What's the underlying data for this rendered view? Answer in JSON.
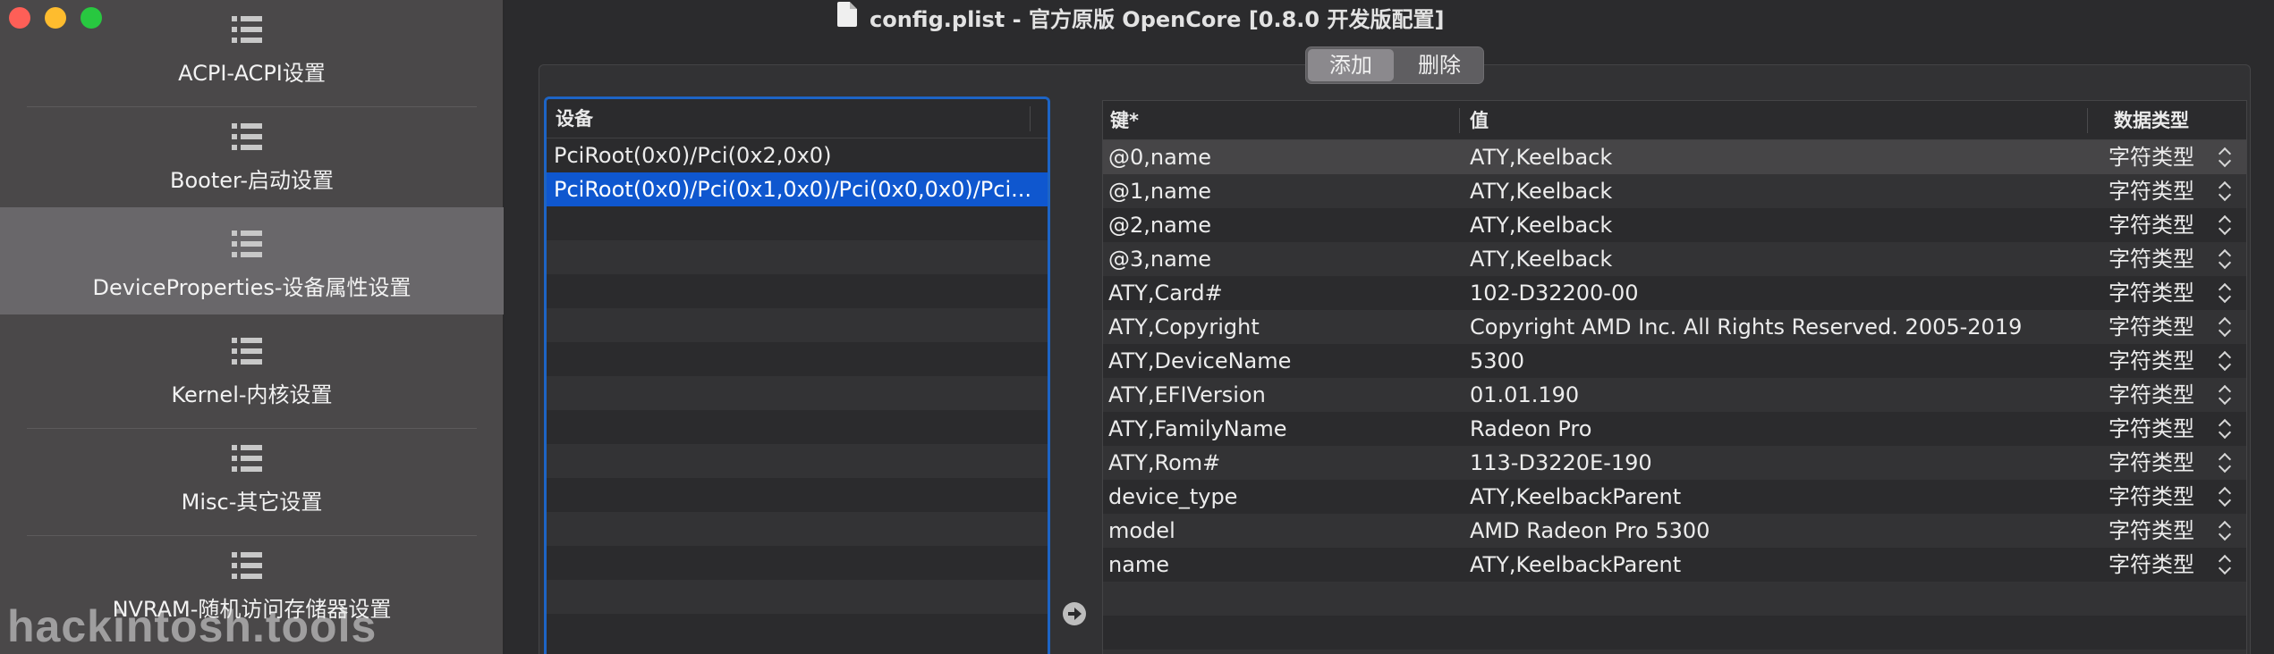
{
  "window": {
    "title": "config.plist - 官方原版 OpenCore [0.8.0 开发版配置]"
  },
  "sidebar": {
    "items": [
      {
        "label": "ACPI-ACPI设置"
      },
      {
        "label": "Booter-启动设置"
      },
      {
        "label": "DeviceProperties-设备属性设置",
        "active": true
      },
      {
        "label": "Kernel-内核设置"
      },
      {
        "label": "Misc-其它设置"
      },
      {
        "label": "NVRAM-随机访问存储器设置"
      }
    ]
  },
  "toolbar": {
    "add_label": "添加",
    "delete_label": "删除"
  },
  "devices": {
    "header": "设备",
    "rows": [
      "PciRoot(0x0)/Pci(0x2,0x0)",
      "PciRoot(0x0)/Pci(0x1,0x0)/Pci(0x0,0x0)/Pci..."
    ],
    "selected_index": 1
  },
  "properties": {
    "headers": {
      "key": "键*",
      "value": "值",
      "type": "数据类型"
    },
    "rows": [
      {
        "key": "@0,name",
        "value": "ATY,Keelback",
        "type": "字符类型"
      },
      {
        "key": "@1,name",
        "value": "ATY,Keelback",
        "type": "字符类型"
      },
      {
        "key": "@2,name",
        "value": "ATY,Keelback",
        "type": "字符类型"
      },
      {
        "key": "@3,name",
        "value": "ATY,Keelback",
        "type": "字符类型"
      },
      {
        "key": "ATY,Card#",
        "value": "102-D32200-00",
        "type": "字符类型"
      },
      {
        "key": "ATY,Copyright",
        "value": "Copyright AMD Inc. All Rights Reserved. 2005-2019",
        "type": "字符类型"
      },
      {
        "key": "ATY,DeviceName",
        "value": "5300",
        "type": "字符类型"
      },
      {
        "key": "ATY,EFIVersion",
        "value": "01.01.190",
        "type": "字符类型"
      },
      {
        "key": "ATY,FamilyName",
        "value": "Radeon Pro",
        "type": "字符类型"
      },
      {
        "key": "ATY,Rom#",
        "value": "113-D3220E-190",
        "type": "字符类型"
      },
      {
        "key": "device_type",
        "value": "ATY,KeelbackParent",
        "type": "字符类型"
      },
      {
        "key": "model",
        "value": "AMD Radeon Pro 5300",
        "type": "字符类型"
      },
      {
        "key": "name",
        "value": "ATY,KeelbackParent",
        "type": "字符类型"
      }
    ],
    "highlighted_index": 0
  },
  "watermark": "hackintosh.tools",
  "colors": {
    "selection": "#0f57cf",
    "focus_ring": "#1d64c5",
    "sidebar_bg": "#4a4849",
    "sidebar_active": "#69676a"
  }
}
